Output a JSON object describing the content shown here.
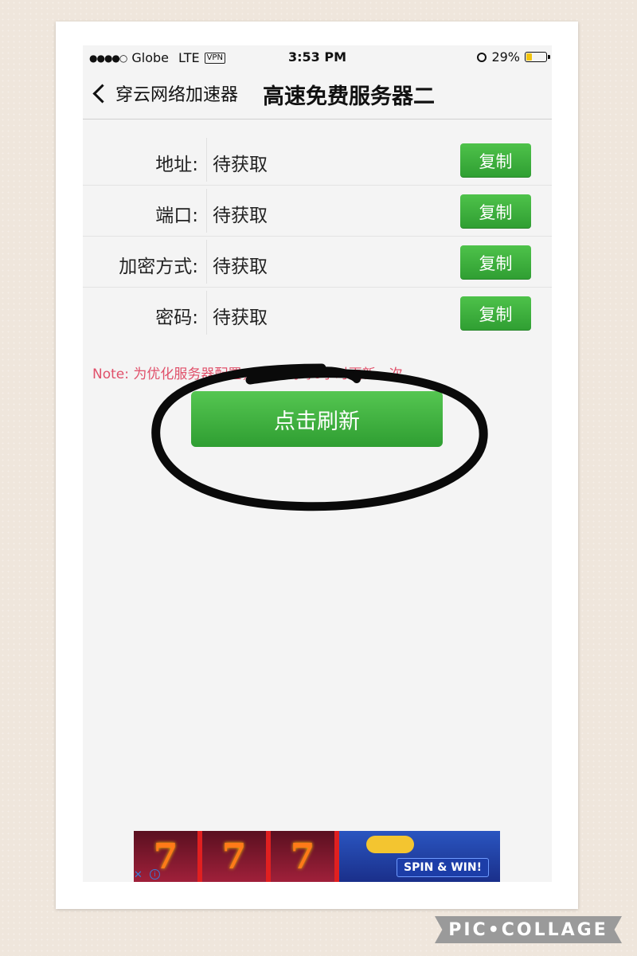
{
  "status_bar": {
    "carrier": "Globe",
    "network": "LTE",
    "vpn": "VPN",
    "time": "3:53 PM",
    "battery": "29%"
  },
  "nav": {
    "back_label": "穿云网络加速器",
    "title": "高速免费服务器二"
  },
  "rows": [
    {
      "label": "地址:",
      "value": "待获取",
      "button": "复制"
    },
    {
      "label": "端口:",
      "value": "待获取",
      "button": "复制"
    },
    {
      "label": "加密方式:",
      "value": "待获取",
      "button": "复制"
    },
    {
      "label": "密码:",
      "value": "待获取",
      "button": "复制"
    }
  ],
  "note": "Note: 为优化服务器配置，SS密码每6小时更新一次。",
  "refresh_button": "点击刷新",
  "ad": {
    "slot_symbol": "7",
    "spin_label": "SPIN & WIN!",
    "close": "✕",
    "info": "i"
  },
  "watermark": "PIC•COLLAGE",
  "colors": {
    "accent_green": "#3aae3a",
    "note_red": "#e0506a",
    "background": "#efe6dc"
  }
}
